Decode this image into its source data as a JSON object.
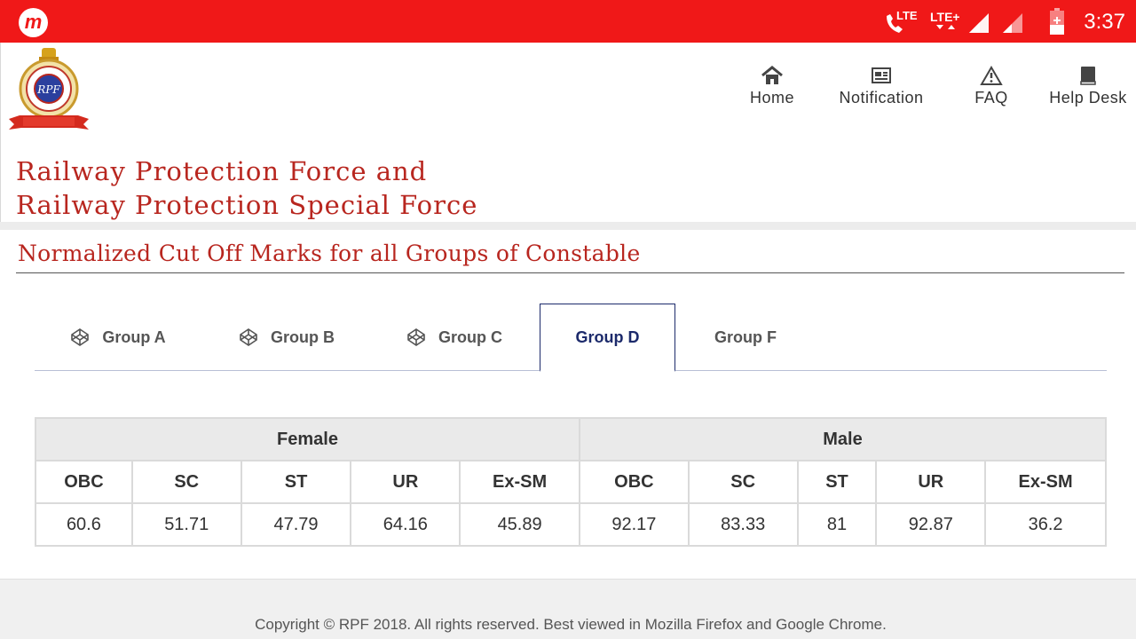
{
  "status_bar": {
    "network_1": "LTE",
    "network_2": "LTE+",
    "time": "3:37"
  },
  "header": {
    "emblem_text": "RPF",
    "title_line1": "Railway Protection Force and",
    "title_line2": "Railway Protection Special Force"
  },
  "nav": {
    "items": [
      {
        "label": "Home",
        "icon": "home-icon"
      },
      {
        "label": "Notification",
        "icon": "newspaper-icon"
      },
      {
        "label": "FAQ",
        "icon": "warning-icon"
      },
      {
        "label": "Help Desk",
        "icon": "book-icon"
      }
    ]
  },
  "section": {
    "title": "Normalized Cut Off Marks for all Groups of Constable"
  },
  "tabs": [
    {
      "label": "Group A",
      "icon": "codepen-icon",
      "active": false
    },
    {
      "label": "Group B",
      "icon": "codepen-icon",
      "active": false
    },
    {
      "label": "Group C",
      "icon": "codepen-icon",
      "active": false
    },
    {
      "label": "Group D",
      "active": true
    },
    {
      "label": "Group F",
      "active": false
    }
  ],
  "table": {
    "groups": [
      "Female",
      "Male"
    ],
    "categories": [
      "OBC",
      "SC",
      "ST",
      "UR",
      "Ex-SM",
      "OBC",
      "SC",
      "ST",
      "UR",
      "Ex-SM"
    ],
    "values": [
      "60.6",
      "51.71",
      "47.79",
      "64.16",
      "45.89",
      "92.17",
      "83.33",
      "81",
      "92.87",
      "36.2"
    ]
  },
  "footer": {
    "text": "Copyright © RPF 2018. All rights reserved. Best viewed in Mozilla Firefox and Google Chrome."
  },
  "colors": {
    "status_bar": "#f01818",
    "brand_red": "#b8261f",
    "active_tab": "#1c2a6b"
  }
}
